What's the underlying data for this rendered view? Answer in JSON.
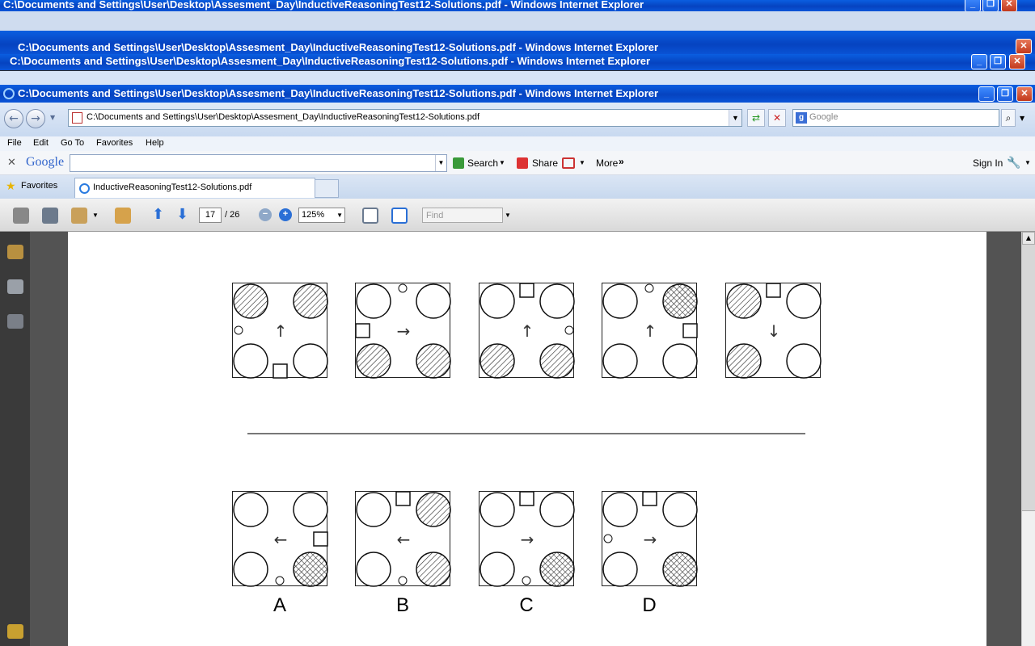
{
  "windows": {
    "title": "C:\\Documents and Settings\\User\\Desktop\\Assesment_Day\\InductiveReasoningTest12-Solutions.pdf - Windows Internet Explorer"
  },
  "nav": {
    "address": "C:\\Documents and Settings\\User\\Desktop\\Assesment_Day\\InductiveReasoningTest12-Solutions.pdf",
    "search_placeholder": "Google"
  },
  "menu": {
    "file": "File",
    "edit": "Edit",
    "goto": "Go To",
    "favorites": "Favorites",
    "help": "Help"
  },
  "google_bar": {
    "logo": "Google",
    "search_label": "Search",
    "share_label": "Share",
    "more_label": "More",
    "signin_label": "Sign In"
  },
  "favbar": {
    "favorites_label": "Favorites",
    "tab_title": "InductiveReasoningTest12-Solutions.pdf"
  },
  "pdf_toolbar": {
    "page_current": "17",
    "page_total": "/ 26",
    "zoom": "125%",
    "find_placeholder": "Find"
  },
  "puzzle": {
    "question_figures": [
      {
        "shading": [
          "hatch",
          "hatch",
          "none",
          "none"
        ],
        "arrow": "up",
        "small_circle": "left",
        "square": "bottom"
      },
      {
        "shading": [
          "none",
          "none",
          "hatch",
          "hatch"
        ],
        "arrow": "right",
        "small_circle": "top",
        "square": "left"
      },
      {
        "shading": [
          "none",
          "none",
          "hatch",
          "hatch"
        ],
        "arrow": "up",
        "small_circle": "right",
        "square": "top"
      },
      {
        "shading": [
          "none",
          "cross",
          "none",
          "none"
        ],
        "arrow": "up",
        "small_circle": "top",
        "square": "right"
      },
      {
        "shading": [
          "hatch",
          "none",
          "hatch",
          "none"
        ],
        "arrow": "down",
        "small_circle": "top",
        "square": "top"
      }
    ],
    "answer_figures": [
      {
        "label": "A",
        "shading": [
          "none",
          "none",
          "none",
          "cross"
        ],
        "arrow": "left",
        "small_circle": "bottom",
        "square": "right"
      },
      {
        "label": "B",
        "shading": [
          "none",
          "hatch",
          "none",
          "hatch"
        ],
        "arrow": "left",
        "small_circle": "bottom",
        "square": "top"
      },
      {
        "label": "C",
        "shading": [
          "none",
          "none",
          "none",
          "cross"
        ],
        "arrow": "right",
        "small_circle": "bottom",
        "square": "top"
      },
      {
        "label": "D",
        "shading": [
          "none",
          "none",
          "none",
          "cross"
        ],
        "arrow": "right",
        "small_circle": "left",
        "square": "top"
      }
    ]
  }
}
